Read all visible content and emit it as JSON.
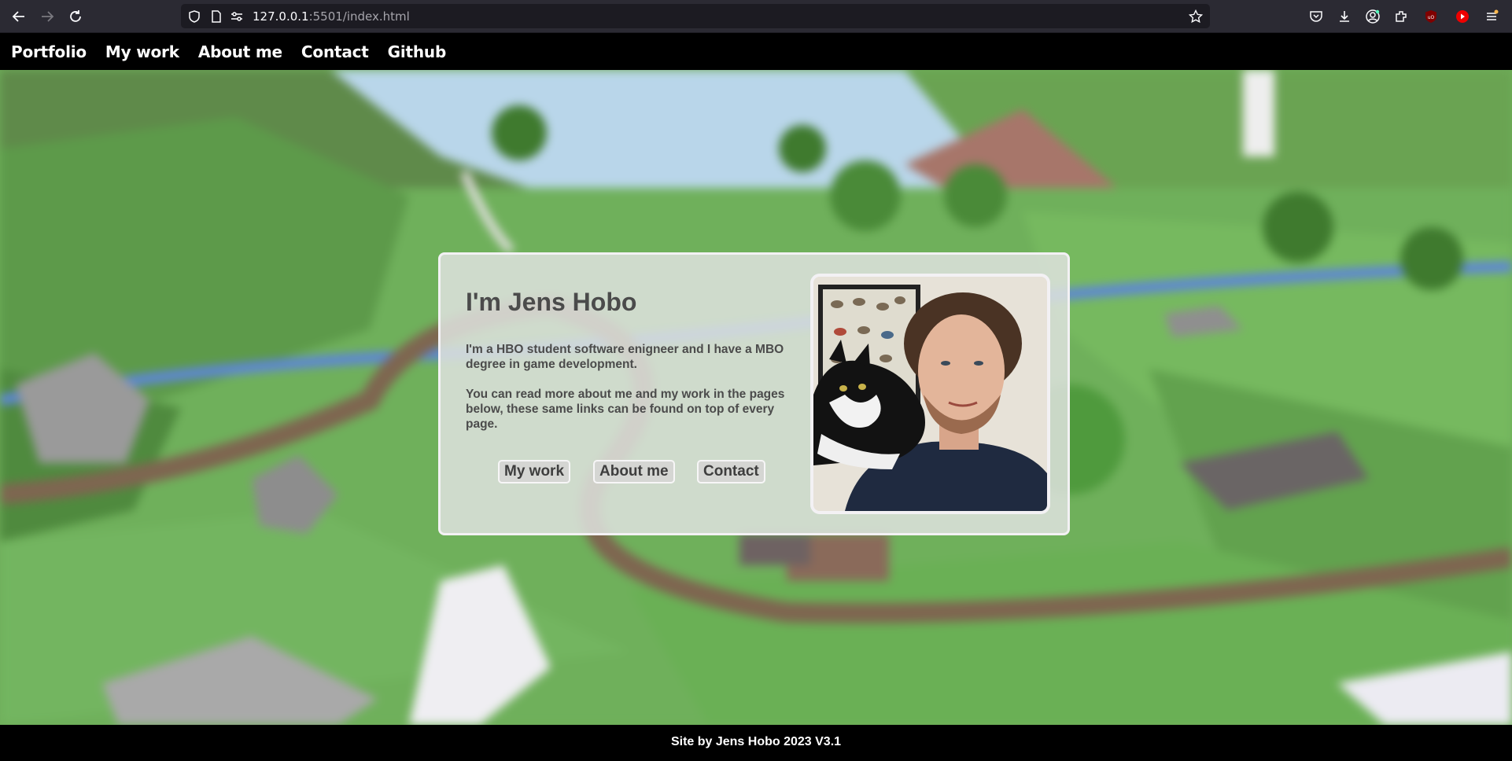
{
  "browser": {
    "url_host": "127.0.0.1",
    "url_rest": ":5501/index.html",
    "icons": [
      "back-icon",
      "forward-icon",
      "reload-icon",
      "shield-icon",
      "page-icon",
      "permissions-icon",
      "bookmark-star-icon",
      "pocket-icon",
      "download-icon",
      "account-icon",
      "extensions-icon",
      "ublock-icon",
      "youtube-icon",
      "menu-icon"
    ]
  },
  "nav": {
    "items": [
      "Portfolio",
      "My work",
      "About me",
      "Contact",
      "Github"
    ]
  },
  "card": {
    "title": "I'm Jens Hobo",
    "paragraph1": "I'm a HBO student software enigneer and I have a MBO degree in game development.",
    "paragraph2": "You can read more about me and my work in the pages below, these same links can be found on top of every page.",
    "buttons": [
      "My work",
      "About me",
      "Contact"
    ]
  },
  "footer": {
    "text": "Site by Jens Hobo 2023 V3.1"
  },
  "colors": {
    "chrome_bg": "#2b2a33",
    "urlbar_bg": "#1c1b22",
    "nav_bg": "#000000",
    "card_bg": "#dee2de",
    "text": "#4b4b4b"
  }
}
